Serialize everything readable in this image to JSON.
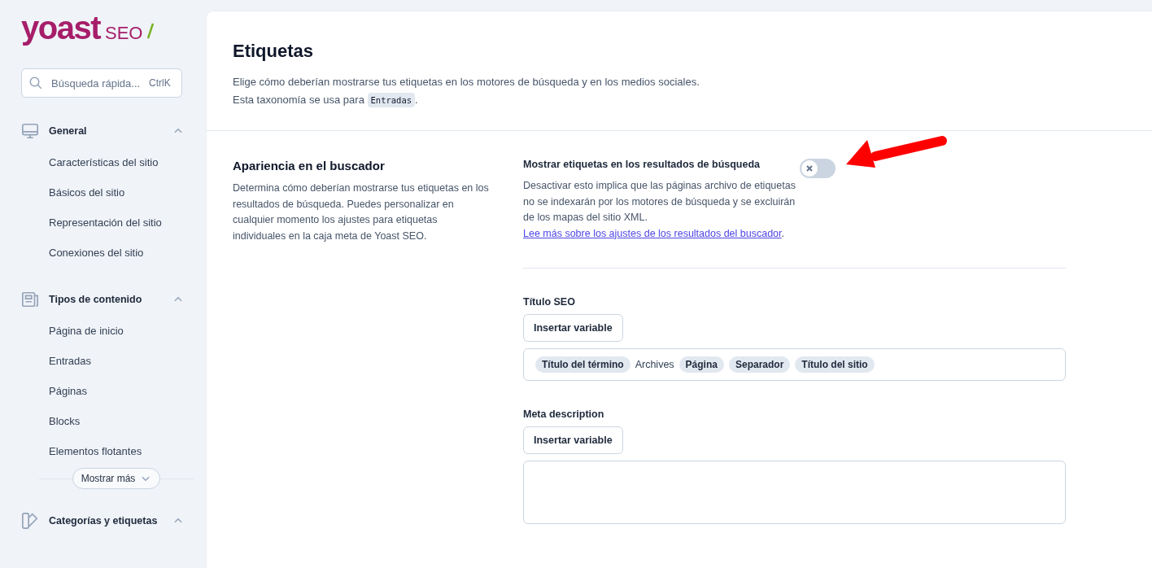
{
  "logo": {
    "name": "yoast",
    "suffix": "SEO"
  },
  "search": {
    "placeholder": "Búsqueda rápida...",
    "shortcut": "CtrlK"
  },
  "sidebar": {
    "groups": [
      {
        "kind": "monitor",
        "label": "General",
        "expanded": true,
        "items": [
          "Características del sitio",
          "Básicos del sitio",
          "Representación del sitio",
          "Conexiones del sitio"
        ]
      },
      {
        "kind": "document",
        "label": "Tipos de contenido",
        "expanded": true,
        "items": [
          "Página de inicio",
          "Entradas",
          "Páginas",
          "Blocks",
          "Elementos flotantes"
        ],
        "more": "Mostrar más"
      },
      {
        "kind": "tag",
        "label": "Categorías y etiquetas",
        "expanded": true
      }
    ]
  },
  "header": {
    "title": "Etiquetas",
    "description": "Elige cómo deberían mostrarse tus etiquetas en los motores de búsqueda y en los medios sociales.",
    "usage_prefix": "Esta taxonomía se usa para",
    "usage_code": "Entradas",
    "usage_suffix": "."
  },
  "section": {
    "title": "Apariencia en el buscador",
    "description": "Determina cómo deberían mostrarse tus etiquetas en los resultados de búsqueda. Puedes personalizar en cualquier momento los ajustes para etiquetas individuales en la caja meta de Yoast SEO.",
    "toggle": {
      "label": "Mostrar etiquetas en los resultados de búsqueda",
      "on": false,
      "description": "Desactivar esto implica que las páginas archivo de etiquetas no se indexarán por los motores de búsqueda y se excluirán de los mapas del sitio XML.",
      "link": "Lee más sobre los ajustes de los resultados del buscador",
      "after_link": "."
    },
    "fields": [
      {
        "label": "Título SEO",
        "button": "Insertar variable",
        "kind": "single",
        "segments": [
          {
            "kind": "variable",
            "text": "Título del término"
          },
          {
            "kind": "text",
            "text": "Archives"
          },
          {
            "kind": "variable",
            "text": "Página"
          },
          {
            "kind": "variable",
            "text": "Separador"
          },
          {
            "kind": "variable",
            "text": "Título del sitio"
          }
        ]
      },
      {
        "label": "Meta description",
        "button": "Insertar variable",
        "kind": "multi"
      }
    ]
  }
}
